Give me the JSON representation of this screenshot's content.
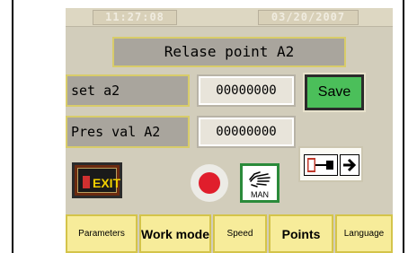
{
  "topbar": {
    "time": "11:27:08",
    "date": "03/20/2007"
  },
  "title": "Relase point  A2",
  "fields": [
    {
      "label": "set a2",
      "value": "00000000"
    },
    {
      "label": "Pres val A2",
      "value": "00000000"
    }
  ],
  "save_label": "Save",
  "exit_label": "EXIT",
  "man_label": "MAN",
  "tabs": [
    "Parameters",
    "Work mode",
    "Speed",
    "Points",
    "Language"
  ],
  "colors": {
    "panel": "#d2cdbb",
    "save": "#4bbf5a",
    "record": "#e01e2c",
    "tab": "#f7ec9a",
    "exit_text": "#f2d000"
  },
  "icons": {
    "exit": "exit-door-icon",
    "record": "record-icon",
    "manual": "hand-manual-icon",
    "cylinder": "cylinder-icon",
    "arrow": "arrow-right-icon"
  }
}
